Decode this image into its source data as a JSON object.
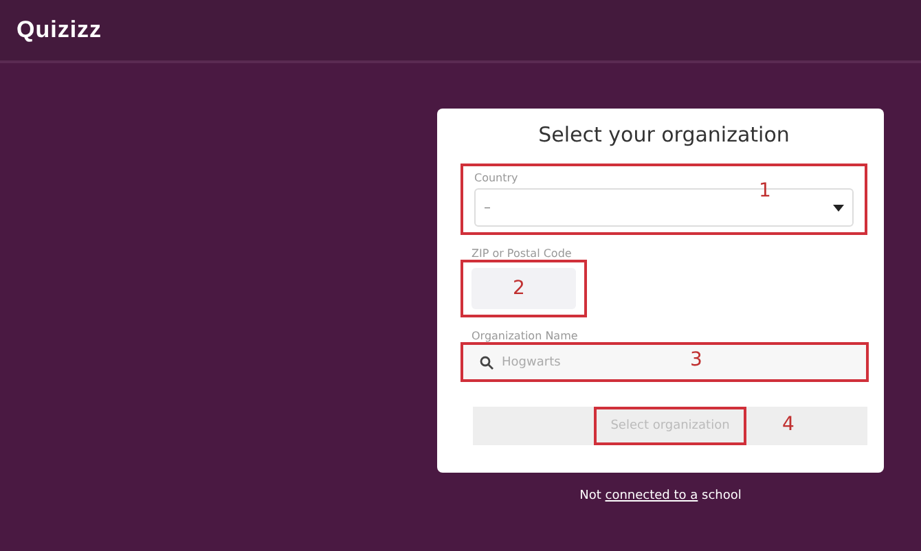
{
  "header": {
    "logo": "Quizizz"
  },
  "card": {
    "title": "Select your organization",
    "country": {
      "label": "Country",
      "value": "–",
      "annotation": "1"
    },
    "zip": {
      "label": "ZIP or Postal Code",
      "annotation": "2"
    },
    "organization": {
      "label": "Organization Name",
      "placeholder": "Hogwarts",
      "annotation": "3"
    },
    "button": {
      "label": "Select organization",
      "disabled": true,
      "annotation": "4"
    }
  },
  "footer": {
    "before": "Not ",
    "link": "connected to a",
    "after": " school"
  }
}
